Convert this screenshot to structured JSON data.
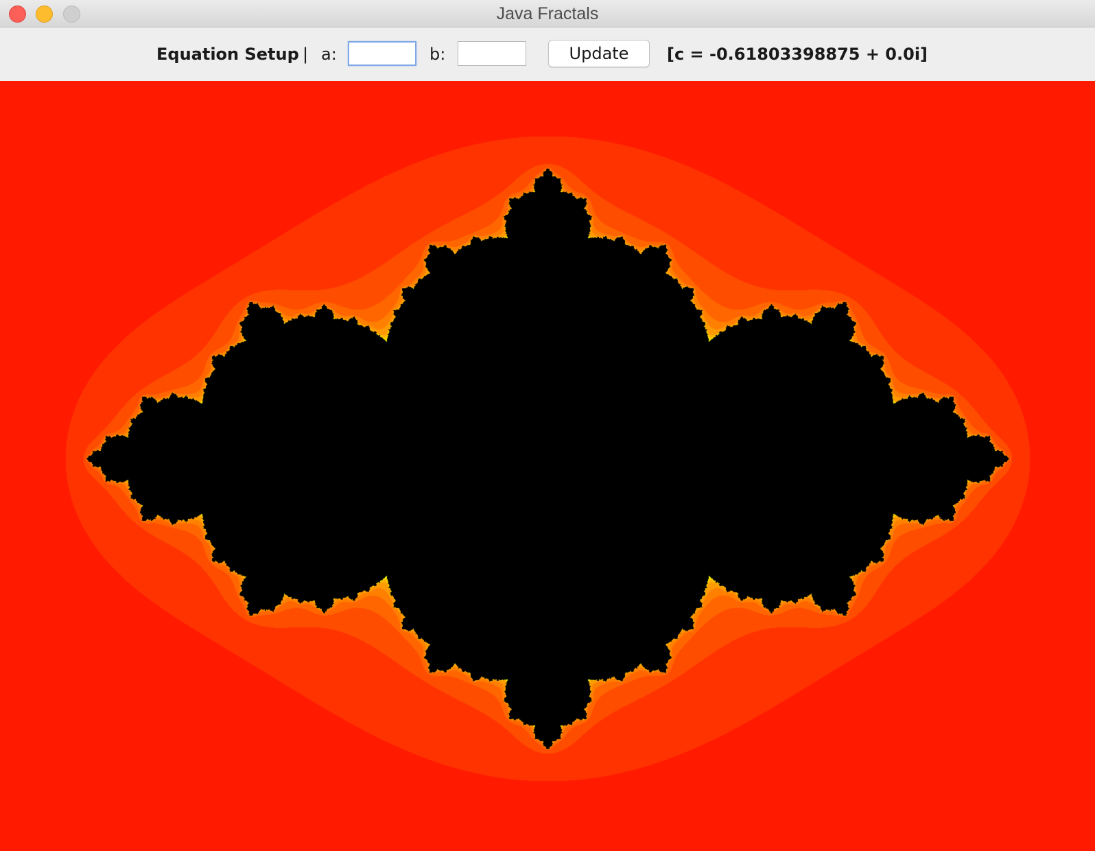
{
  "window": {
    "title": "Java Fractals"
  },
  "toolbar": {
    "setup_label": "Equation Setup",
    "separator": "|",
    "a_label": "a:",
    "a_value": "",
    "b_label": "b:",
    "b_value": "",
    "update_label": "Update",
    "c_display": "[c = -0.61803398875 + 0.0i]"
  },
  "fractal": {
    "type": "julia",
    "c_real": -0.61803398875,
    "c_imag": 0.0,
    "interior_color": "#000000",
    "palette": [
      "#ff1a00",
      "#ff3300",
      "#ff4d00",
      "#ff6600",
      "#ff8000",
      "#ff9a00",
      "#ffb300",
      "#ffcc00",
      "#ffe600",
      "#e6ff00"
    ]
  }
}
